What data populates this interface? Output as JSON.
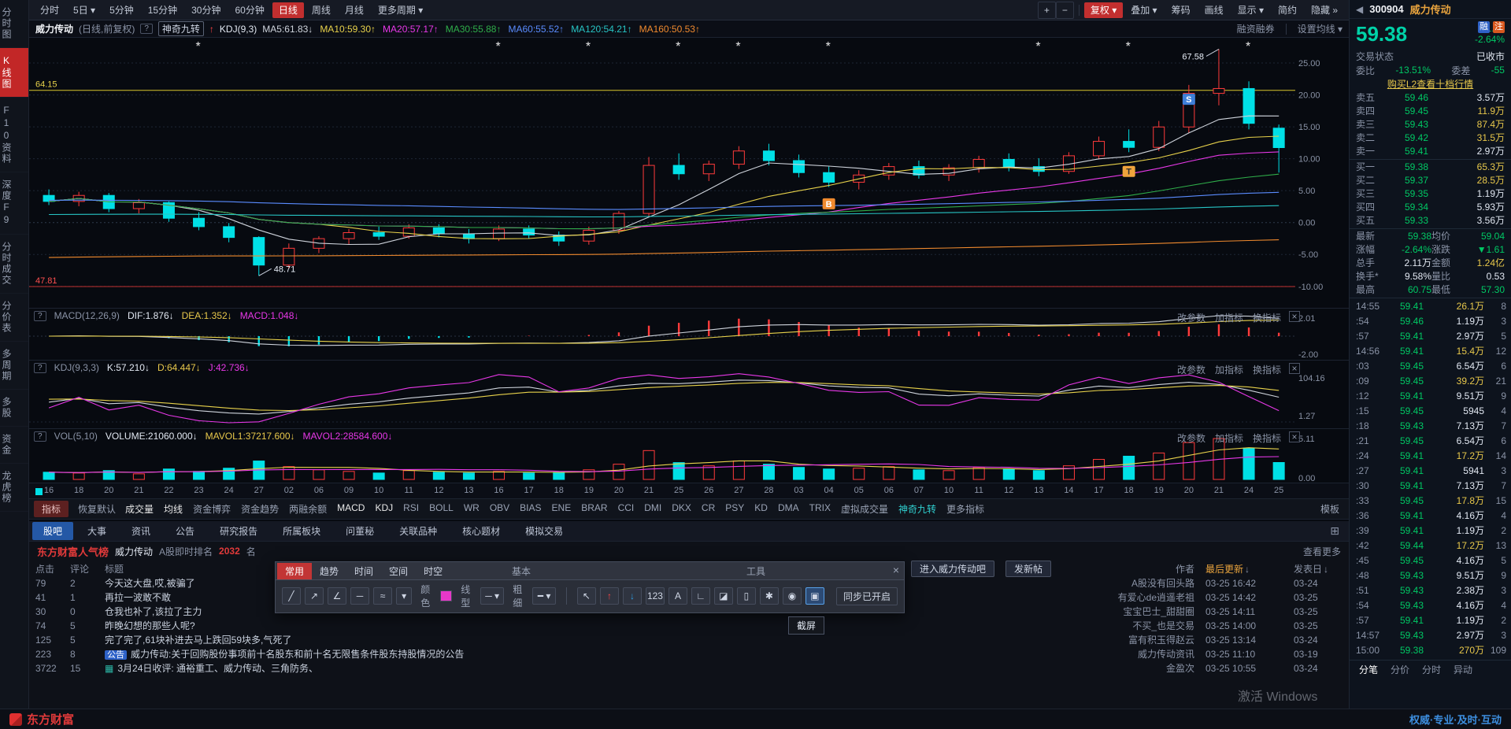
{
  "topbar": {
    "arrow_glyph": "▾",
    "zoom_in": "+",
    "zoom_out": "−",
    "periods": [
      {
        "t": "分时"
      },
      {
        "t": "5日",
        "a": 1
      },
      {
        "t": "5分钟"
      },
      {
        "t": "15分钟"
      },
      {
        "t": "30分钟"
      },
      {
        "t": "60分钟"
      },
      {
        "t": "日线",
        "active": 1
      },
      {
        "t": "周线"
      },
      {
        "t": "月线"
      },
      {
        "t": "更多周期",
        "a": 1
      }
    ],
    "actions": [
      {
        "t": "复权",
        "a": 1,
        "active": 1
      },
      {
        "t": "叠加",
        "a": 1
      },
      {
        "t": "筹码"
      },
      {
        "t": "画线"
      },
      {
        "t": "显示",
        "a": 1
      },
      {
        "t": "简约"
      },
      {
        "t": "隐藏",
        "suffix": " »"
      }
    ]
  },
  "sidebar": {
    "items": [
      {
        "t": "分时图"
      },
      {
        "t": "K线图",
        "active": 1
      },
      {
        "t": "F10资料"
      },
      {
        "t": "深度F9"
      },
      {
        "t": "分时成交"
      },
      {
        "t": "分价表"
      },
      {
        "t": "多周期"
      },
      {
        "t": "多股"
      },
      {
        "t": "资金"
      },
      {
        "t": "龙虎榜"
      }
    ]
  },
  "chart_header": {
    "stock": "威力传动",
    "mode": "(日线,前复权)",
    "help": "?",
    "magic": "神奇九转",
    "arrow": "↑",
    "kdj": "KDJ(9,3)",
    "right1": "融资融券",
    "right2": "设置均线 ▾",
    "mas": [
      {
        "text": "MA5:61.83↓",
        "color": "#cfd4dc"
      },
      {
        "text": "MA10:59.30↑",
        "color": "#e8d24b"
      },
      {
        "text": "MA20:57.17↑",
        "color": "#e838e8"
      },
      {
        "text": "MA30:55.88↑",
        "color": "#2fae4a"
      },
      {
        "text": "MA60:55.52↑",
        "color": "#5a8cff"
      },
      {
        "text": "MA120:54.21↑",
        "color": "#27c5c5"
      },
      {
        "text": "MA160:50.53↑",
        "color": "#f08a2e"
      }
    ]
  },
  "panel_help": "?",
  "panel_actions": {
    "p1": "改参数",
    "p2": "加指标",
    "p3": "换指标",
    "close": "×"
  },
  "macd_panel": {
    "name": "MACD(12,26,9)",
    "dif": "DIF:1.876↓",
    "dea": "DEA:1.352↓",
    "macd": "MACD:1.048↓"
  },
  "kdj_panel": {
    "name": "KDJ(9,3,3)",
    "k": "K:57.210↓",
    "d": "D:64.447↓",
    "j": "J:42.736↓"
  },
  "vol_panel": {
    "name": "VOL(5,10)",
    "v": "VOLUME:21060.000↓",
    "m1": "MAVOL1:37217.600↓",
    "m2": "MAVOL2:28584.600↓"
  },
  "indicator_bar": {
    "tab": "指标",
    "reset": "恢复默认",
    "items": [
      {
        "t": "成交量",
        "on": 1
      },
      {
        "t": "均线",
        "on": 1
      },
      {
        "t": "资金博弈"
      },
      {
        "t": "资金趋势"
      },
      {
        "t": "两融余额"
      },
      {
        "t": "MACD",
        "on": 1
      },
      {
        "t": "KDJ",
        "on": 1
      },
      {
        "t": "RSI"
      },
      {
        "t": "BOLL"
      },
      {
        "t": "WR"
      },
      {
        "t": "OBV"
      },
      {
        "t": "BIAS"
      },
      {
        "t": "ENE"
      },
      {
        "t": "BRAR"
      },
      {
        "t": "CCI"
      },
      {
        "t": "DMI"
      },
      {
        "t": "DKX"
      },
      {
        "t": "CR"
      },
      {
        "t": "PSY"
      },
      {
        "t": "KD"
      },
      {
        "t": "DMA"
      },
      {
        "t": "TRIX"
      },
      {
        "t": "虚拟成交量"
      },
      {
        "t": "神奇九转",
        "magic": 1
      },
      {
        "t": "更多指标"
      }
    ],
    "template": "模板"
  },
  "content_tabs": {
    "items": [
      {
        "t": "股吧",
        "active": 1
      },
      {
        "t": "大事"
      },
      {
        "t": "资讯"
      },
      {
        "t": "公告"
      },
      {
        "t": "研究报告"
      },
      {
        "t": "所属板块"
      },
      {
        "t": "问董秘"
      },
      {
        "t": "关联品种"
      },
      {
        "t": "核心题材"
      },
      {
        "t": "模拟交易"
      }
    ],
    "corner_icon": "⊞"
  },
  "forum": {
    "brand": "东方财富人气榜",
    "stock": "威力传动",
    "rank_label": "A股即时排名",
    "rank": "2032",
    "rank_suffix": "名",
    "more": "查看更多",
    "enter_btn": "进入威力传动吧",
    "post_btn": "发新帖",
    "col_clicks": "点击",
    "col_comments": "评论",
    "col_title": "标题",
    "col_author": "作者",
    "col_updated": "最后更新",
    "col_posted": "发表日",
    "sort_arrow": "↓",
    "rows": [
      {
        "clicks": "79",
        "comments": "2",
        "title": "今天这大盘,哎,被骗了",
        "author": "A股没有回头路",
        "updated": "03-25 16:42",
        "posted": "03-24"
      },
      {
        "clicks": "41",
        "comments": "1",
        "title": "再拉一波敢不敢",
        "author": "有爱心de逍遥老祖",
        "updated": "03-25 14:42",
        "posted": "03-25"
      },
      {
        "clicks": "30",
        "comments": "0",
        "title": "仓我也补了,该拉了主力",
        "author": "宝宝巴士_甜甜圈",
        "updated": "03-25 14:11",
        "posted": "03-25"
      },
      {
        "clicks": "74",
        "comments": "5",
        "title": "昨晚幻想的那些人呢?",
        "author": "不买_也是交易",
        "updated": "03-25 14:00",
        "posted": "03-25"
      },
      {
        "clicks": "125",
        "comments": "5",
        "title": "完了完了,61块补进去马上跌回59块多,气死了",
        "author": "富有积玉得赵云",
        "updated": "03-25 13:14",
        "posted": "03-24"
      },
      {
        "clicks": "223",
        "comments": "8",
        "badge": "公告",
        "title": "威力传动:关于回购股份事项前十名股东和前十名无限售条件股东持股情况的公告",
        "author": "威力传动资讯",
        "updated": "03-25 11:10",
        "posted": "03-19"
      },
      {
        "clicks": "3722",
        "comments": "15",
        "icon": "image",
        "title": "3月24日收评: 通裕重工、威力传动、三角防务、",
        "author": "金盈次",
        "updated": "03-25 10:55",
        "posted": "03-24"
      }
    ]
  },
  "draw_toolbar": {
    "tabs": [
      {
        "t": "常用",
        "active": 1
      },
      {
        "t": "趋势"
      },
      {
        "t": "时间"
      },
      {
        "t": "空间"
      },
      {
        "t": "时空"
      }
    ],
    "sec_basic": "基本",
    "sec_tools": "工具",
    "close": "×",
    "basic": [
      {
        "n": "segment-tool",
        "g": "╱"
      },
      {
        "n": "ray-line-tool",
        "g": "↗"
      },
      {
        "n": "angle-tool",
        "g": "∠"
      },
      {
        "n": "horizontal-line-tool",
        "g": "─"
      },
      {
        "n": "wave-line-tool",
        "g": "≈"
      }
    ],
    "dropdown_glyph": "▾",
    "color_label": "颜色",
    "color_value": "#e838c8",
    "line_label": "线型",
    "line_glyph": "─ ▾",
    "weight_label": "粗细",
    "weight_glyph": "━ ▾",
    "tools": [
      {
        "n": "cursor-tool",
        "g": "↖"
      },
      {
        "n": "mark-up-tool",
        "g": "↑",
        "c": "#ff4545"
      },
      {
        "n": "mark-down-tool",
        "g": "↓",
        "c": "#2e9fe6"
      },
      {
        "n": "number-mark-tool",
        "g": "123"
      },
      {
        "n": "text-tool",
        "g": "A"
      },
      {
        "n": "measure-tool",
        "g": "∟"
      },
      {
        "n": "eraser-tool",
        "g": "◪"
      },
      {
        "n": "clear-all-tool",
        "g": "▯"
      },
      {
        "n": "settings-tool",
        "g": "✱"
      },
      {
        "n": "visibility-tool",
        "g": "◉"
      },
      {
        "n": "screenshot-tool",
        "g": "▣",
        "active": 1
      }
    ],
    "sync": "同步已开启",
    "tooltip": "截屏"
  },
  "quote_panel": {
    "collapse_arrow": "◀",
    "code": "300904",
    "name": "威力传动",
    "badges": [
      "融",
      "注"
    ],
    "price": "59.38",
    "change": "-1.61",
    "change_pct": "-2.64%",
    "status_label": "交易状态",
    "status_value": "已收市",
    "weibi_label": "委比",
    "weibi": "-13.51%",
    "weicha_label": "委差",
    "weicha": "-55",
    "l2_link": "购买L2查看十档行情",
    "asks": [
      [
        "卖五",
        "59.46",
        "3.57万"
      ],
      [
        "卖四",
        "59.45",
        "11.9万"
      ],
      [
        "卖三",
        "59.43",
        "87.4万"
      ],
      [
        "卖二",
        "59.42",
        "31.5万"
      ],
      [
        "卖一",
        "59.41",
        "2.97万"
      ]
    ],
    "bids": [
      [
        "买一",
        "59.38",
        "65.3万"
      ],
      [
        "买二",
        "59.37",
        "28.5万"
      ],
      [
        "买三",
        "59.35",
        "1.19万"
      ],
      [
        "买四",
        "59.34",
        "5.93万"
      ],
      [
        "买五",
        "59.33",
        "3.56万"
      ]
    ],
    "stats": [
      {
        "l1": "最新",
        "v1": "59.38",
        "c1": "dn",
        "l2": "均价",
        "v2": "59.04",
        "c2": "dn"
      },
      {
        "l1": "涨幅",
        "v1": "-2.64%",
        "c1": "dn",
        "l2": "涨跌",
        "v2": "▼1.61",
        "c2": "dn"
      },
      {
        "l1": "总手",
        "v1": "2.11万",
        "c1": "wh",
        "l2": "金额",
        "v2": "1.24亿",
        "c2": "yl"
      },
      {
        "l1": "换手*",
        "v1": "9.58%",
        "c1": "wh",
        "l2": "量比",
        "v2": "0.53",
        "c2": "wh"
      },
      {
        "l1": "最高",
        "v1": "60.75",
        "c1": "dn",
        "l2": "最低",
        "v2": "57.30",
        "c2": "dn"
      }
    ],
    "ticks": [
      [
        "14:55",
        "59.41",
        "26.1万",
        "8"
      ],
      [
        ":54",
        "59.46",
        "1.19万",
        "3"
      ],
      [
        ":57",
        "59.41",
        "2.97万",
        "5"
      ],
      [
        "14:56",
        "59.41",
        "15.4万",
        "12"
      ],
      [
        ":03",
        "59.45",
        "6.54万",
        "6"
      ],
      [
        ":09",
        "59.45",
        "39.2万",
        "21"
      ],
      [
        ":12",
        "59.41",
        "9.51万",
        "9"
      ],
      [
        ":15",
        "59.45",
        "5945",
        "4"
      ],
      [
        ":18",
        "59.43",
        "7.13万",
        "7"
      ],
      [
        ":21",
        "59.45",
        "6.54万",
        "6"
      ],
      [
        ":24",
        "59.41",
        "17.2万",
        "14"
      ],
      [
        ":27",
        "59.41",
        "5941",
        "3"
      ],
      [
        ":30",
        "59.41",
        "7.13万",
        "7"
      ],
      [
        ":33",
        "59.45",
        "17.8万",
        "15"
      ],
      [
        ":36",
        "59.41",
        "4.16万",
        "4"
      ],
      [
        ":39",
        "59.41",
        "1.19万",
        "2"
      ],
      [
        ":42",
        "59.44",
        "17.2万",
        "13"
      ],
      [
        ":45",
        "59.45",
        "4.16万",
        "5"
      ],
      [
        ":48",
        "59.43",
        "9.51万",
        "9"
      ],
      [
        ":51",
        "59.43",
        "2.38万",
        "3"
      ],
      [
        ":54",
        "59.43",
        "4.16万",
        "4"
      ],
      [
        ":57",
        "59.41",
        "1.19万",
        "2"
      ],
      [
        "14:57",
        "59.43",
        "2.97万",
        "3"
      ],
      [
        "15:00",
        "59.38",
        "270万",
        "109"
      ]
    ],
    "bottom_tabs": [
      {
        "t": "分笔",
        "active": 1
      },
      {
        "t": "分价"
      },
      {
        "t": "分时"
      },
      {
        "t": "异动"
      }
    ]
  },
  "watermark": {
    "line1": "激活 Windows"
  },
  "bottom_bar": {
    "logo": "东方财富",
    "slogan": "权威·专业·及时·互动"
  },
  "chart_data": {
    "type": "candlestick",
    "symbol": "300904",
    "name": "威力传动",
    "period": "日线",
    "adjust": "前复权",
    "pct_base_price": 53.14,
    "ylim": [
      46.5,
      68.0
    ],
    "pct_gridlines": [
      25,
      20,
      15,
      10,
      5,
      0,
      -5,
      -10
    ],
    "pct_axis_labels": [
      "25.00",
      "20.00",
      "15.00",
      "10.00",
      "5.00",
      "0.00",
      "-5.00",
      "-10.00"
    ],
    "hlines": [
      {
        "value": 64.15,
        "label": "64.15",
        "color": "#d8c62c",
        "label_color": "#e8d24b"
      },
      {
        "value": 47.81,
        "label": "47.81",
        "color": "#c23030",
        "label_color": "#ff5050"
      }
    ],
    "annotations": [
      {
        "text": "67.58",
        "index": 39,
        "price": 67.58
      },
      {
        "text": "48.71",
        "index": 7,
        "price": 48.71
      }
    ],
    "signal_markers": [
      {
        "label": "B",
        "index": 26,
        "price": 54.7,
        "color": "#f08a2e",
        "text_color": "#ffffff"
      },
      {
        "label": "T",
        "index": 36,
        "price": 57.4,
        "color": "#f0a43c",
        "text_color": "#303030"
      },
      {
        "label": "S",
        "index": 38,
        "price": 63.4,
        "color": "#3f7fd8",
        "text_color": "#ffffff"
      }
    ],
    "star_indices": [
      5,
      15,
      18,
      21,
      23,
      26,
      33,
      36,
      40
    ],
    "up_color": "#ff3b3b",
    "down_color": "#00e0e6",
    "ma_lines": [
      {
        "name": "MA5",
        "window": 5,
        "color": "#cfd4dc"
      },
      {
        "name": "MA10",
        "window": 10,
        "color": "#e8d24b"
      },
      {
        "name": "MA20",
        "window": 20,
        "color": "#e838e8"
      },
      {
        "name": "MA30",
        "window": 30,
        "color": "#2fae4a"
      },
      {
        "name": "MA60",
        "window": 60,
        "color": "#5a8cff",
        "seed": 55.0
      },
      {
        "name": "MA120",
        "window": 120,
        "color": "#27c5c5",
        "seed": 53.8
      },
      {
        "name": "MA160",
        "window": 160,
        "color": "#f08a2e",
        "seed": 50.2
      }
    ],
    "dates": [
      "16",
      "18",
      "20",
      "21",
      "22",
      "23",
      "24",
      "27",
      "02",
      "06",
      "09",
      "10",
      "11",
      "12",
      "13",
      "16",
      "17",
      "18",
      "19",
      "20",
      "21",
      "25",
      "26",
      "27",
      "28",
      "03",
      "04",
      "05",
      "06",
      "07",
      "10",
      "11",
      "12",
      "13",
      "14",
      "17",
      "18",
      "19",
      "20",
      "21",
      "24",
      "25"
    ],
    "candles": [
      [
        55.4,
        55.9,
        54.6,
        54.9
      ],
      [
        54.9,
        55.7,
        54.5,
        55.4
      ],
      [
        55.4,
        55.6,
        54.0,
        54.3
      ],
      [
        54.3,
        55.1,
        53.9,
        54.8
      ],
      [
        54.8,
        54.9,
        53.2,
        53.5
      ],
      [
        53.5,
        54.0,
        52.5,
        52.8
      ],
      [
        52.8,
        53.1,
        51.5,
        51.9
      ],
      [
        51.9,
        52.0,
        48.71,
        49.6
      ],
      [
        49.6,
        51.4,
        49.3,
        51.0
      ],
      [
        51.0,
        52.0,
        50.6,
        51.8
      ],
      [
        51.8,
        52.6,
        51.3,
        52.3
      ],
      [
        52.3,
        52.8,
        51.7,
        52.0
      ],
      [
        52.0,
        53.0,
        51.8,
        52.7
      ],
      [
        52.7,
        53.0,
        51.9,
        52.2
      ],
      [
        52.2,
        52.6,
        51.4,
        51.8
      ],
      [
        51.8,
        52.9,
        51.6,
        52.6
      ],
      [
        52.6,
        52.9,
        51.8,
        52.1
      ],
      [
        52.1,
        52.4,
        51.2,
        51.6
      ],
      [
        51.6,
        52.8,
        51.3,
        52.5
      ],
      [
        52.5,
        54.1,
        52.2,
        53.9
      ],
      [
        53.9,
        58.6,
        53.6,
        57.9
      ],
      [
        57.9,
        58.9,
        56.7,
        57.2
      ],
      [
        57.2,
        58.3,
        56.6,
        58.0
      ],
      [
        58.0,
        59.5,
        57.6,
        59.1
      ],
      [
        59.1,
        59.7,
        57.9,
        58.3
      ],
      [
        58.3,
        58.8,
        56.9,
        57.3
      ],
      [
        57.3,
        57.8,
        56.1,
        56.5
      ],
      [
        56.5,
        57.5,
        55.9,
        57.1
      ],
      [
        57.1,
        58.1,
        56.7,
        57.8
      ],
      [
        57.8,
        58.3,
        56.8,
        57.1
      ],
      [
        57.1,
        58.0,
        56.6,
        57.7
      ],
      [
        57.7,
        58.7,
        57.3,
        58.4
      ],
      [
        58.4,
        58.9,
        57.4,
        57.8
      ],
      [
        57.8,
        58.5,
        57.0,
        57.4
      ],
      [
        57.4,
        59.0,
        57.2,
        58.7
      ],
      [
        58.7,
        60.3,
        58.4,
        59.9
      ],
      [
        59.9,
        60.9,
        59.0,
        59.4
      ],
      [
        59.4,
        61.6,
        59.1,
        61.1
      ],
      [
        61.1,
        64.6,
        60.6,
        63.9
      ],
      [
        63.9,
        67.58,
        62.9,
        64.3
      ],
      [
        64.3,
        64.9,
        60.9,
        61.4
      ],
      [
        61.0,
        61.3,
        57.3,
        59.38
      ]
    ],
    "volumes_wan": [
      0.9,
      0.8,
      1.1,
      0.7,
      1.3,
      1.0,
      1.4,
      2.3,
      1.6,
      1.2,
      1.0,
      0.8,
      1.1,
      0.9,
      0.8,
      1.0,
      0.8,
      0.9,
      1.2,
      1.9,
      3.6,
      2.1,
      1.7,
      2.3,
      1.9,
      1.5,
      1.3,
      1.4,
      1.6,
      1.2,
      1.1,
      1.5,
      1.3,
      1.1,
      1.7,
      2.5,
      2.9,
      3.3,
      4.6,
      5.1,
      3.9,
      2.11
    ],
    "macd": {
      "axis_labels": [
        "2.01",
        "-2.00"
      ]
    },
    "kdj": {
      "axis_labels": [
        "104.16",
        "1.27"
      ]
    },
    "vol": {
      "axis_labels": [
        "5.11",
        "0.00"
      ]
    }
  }
}
